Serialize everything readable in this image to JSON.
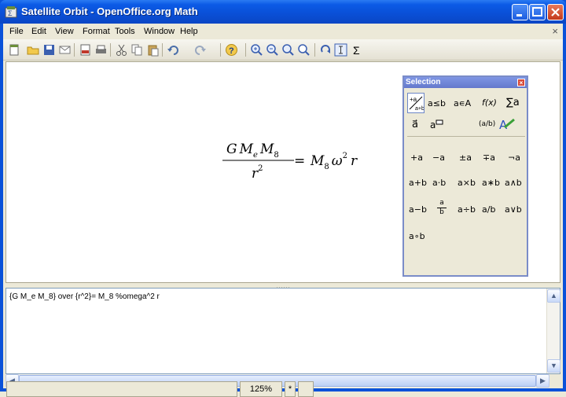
{
  "window": {
    "title": "Satellite Orbit - OpenOffice.org Math"
  },
  "menu": [
    "File",
    "Edit",
    "View",
    "Format",
    "Tools",
    "Window",
    "Help"
  ],
  "menu_close": "×",
  "formula": {
    "num_parts": [
      "G",
      "M",
      "e",
      "M",
      "8"
    ],
    "den": "r",
    "den_exp": "2",
    "equals": "=",
    "rhs_parts": [
      "M",
      "8",
      "ω",
      "2",
      "r"
    ]
  },
  "command": {
    "text": "{G M_e M_8} over {r^2}= M_8 %omega^2 r"
  },
  "selection": {
    "title": "Selection",
    "close": "×",
    "categories": [
      "a≤b",
      "a∊A",
      "f(x)",
      "∑a"
    ],
    "categories2": [
      "a⃗",
      "a",
      "(a/b)",
      "A"
    ],
    "operators": [
      [
        "+a",
        "−a",
        "±a",
        "∓a",
        "¬a"
      ],
      [
        "a+b",
        "a·b",
        "a×b",
        "a∗b",
        "a∧b"
      ],
      [
        "a−b",
        "a/b",
        "a÷b",
        "a/b",
        "a∨b"
      ],
      [
        "a∘b"
      ]
    ],
    "frac_top": "a",
    "frac_bottom": "b"
  },
  "status": {
    "zoom": "125%",
    "modified": "*"
  }
}
